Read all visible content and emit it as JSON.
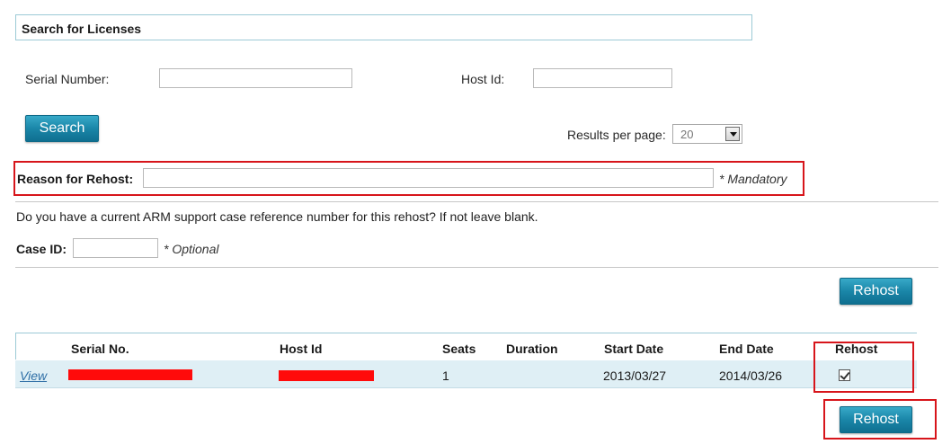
{
  "search": {
    "title": "Search for Licenses",
    "serial_label": "Serial Number:",
    "serial_value": "",
    "host_label": "Host Id:",
    "host_value": "",
    "search_button": "Search",
    "results_label": "Results per page:",
    "results_value": "20"
  },
  "reason": {
    "label": "Reason for Rehost:",
    "value": "",
    "note": "* Mandatory"
  },
  "support": {
    "question": "Do you have a current ARM support case reference number for this rehost? If not leave blank.",
    "case_label": "Case ID:",
    "case_value": "",
    "case_note": "* Optional"
  },
  "rehost_button": "Rehost",
  "table": {
    "headers": [
      "Serial No.",
      "Host Id",
      "Seats",
      "Duration",
      "Start Date",
      "End Date",
      "Rehost"
    ],
    "rows": [
      {
        "view": "View",
        "seats": "1",
        "duration": "",
        "start_date": "2013/03/27",
        "end_date": "2014/03/26",
        "rehost_checked": true
      }
    ]
  },
  "colors": {
    "accent": "#1a86a8",
    "highlight": "#d7151b",
    "row_bg": "#dfeff5"
  }
}
